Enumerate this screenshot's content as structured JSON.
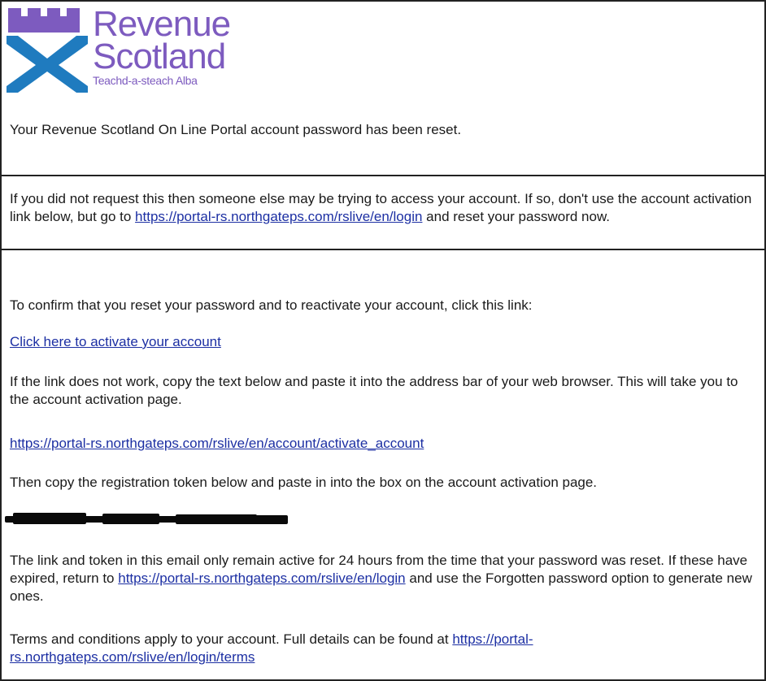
{
  "logo": {
    "line1": "Revenue",
    "line2": "Scotland",
    "tagline": "Teachd-a-steach Alba",
    "color": "#7d5bbf",
    "saltire_color": "#1f7bbf",
    "tower_color": "#7d5bbf"
  },
  "email": {
    "intro": "Your Revenue Scotland On Line Portal account password has been reset.",
    "warning": {
      "text_before": "If you did not request this then someone else may be trying to access your account. If so, don't use the account activation link below, but go to ",
      "link": "https://portal-rs.northgateps.com/rslive/en/login",
      "text_after": " and reset your password now."
    },
    "confirm_text": "To confirm that you reset your password and to reactivate your account, click this link:",
    "activate_link": "Click here to activate your account",
    "fallback_text": "If the link does not work, copy the text below and paste it into the address bar of your web browser. This will take you to the account activation page.",
    "activation_url": "https://portal-rs.northgateps.com/rslive/en/account/activate_account",
    "token_text": "Then copy the registration token below and paste in into the box on the account activation page.",
    "expiry": {
      "text_before": "The link and token in this email only remain active for 24 hours from the time that your password was reset. If these have expired, return to ",
      "link": "https://portal-rs.northgateps.com/rslive/en/login",
      "text_after": " and use the Forgotten password option to generate new ones."
    },
    "terms": {
      "text_before": "Terms and conditions apply to your account. Full details can be found at ",
      "link": "https://portal-rs.northgateps.com/rslive/en/login/terms"
    }
  },
  "colors": {
    "link": "#1c2fa3",
    "text": "#1a1a1a",
    "border": "#222222"
  }
}
